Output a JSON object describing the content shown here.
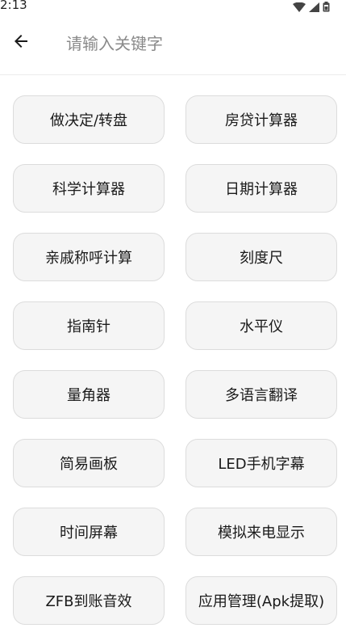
{
  "status": {
    "time": "2:13",
    "icons": [
      "wifi-icon",
      "signal-icon",
      "battery-icon"
    ]
  },
  "header": {
    "back_icon": "arrow-left-icon",
    "search_placeholder": "请输入关键字",
    "search_value": ""
  },
  "tools": [
    {
      "label": "做决定/转盘"
    },
    {
      "label": "房贷计算器"
    },
    {
      "label": "科学计算器"
    },
    {
      "label": "日期计算器"
    },
    {
      "label": "亲戚称呼计算"
    },
    {
      "label": "刻度尺"
    },
    {
      "label": "指南针"
    },
    {
      "label": "水平仪"
    },
    {
      "label": "量角器"
    },
    {
      "label": "多语言翻译"
    },
    {
      "label": "简易画板"
    },
    {
      "label": "LED手机字幕"
    },
    {
      "label": "时间屏幕"
    },
    {
      "label": "模拟来电显示"
    },
    {
      "label": "ZFB到账音效"
    },
    {
      "label": "应用管理(Apk提取)"
    }
  ],
  "colors": {
    "button_bg": "#f5f5f5",
    "button_border": "#dcdcdc",
    "text": "#1a1a1a",
    "placeholder": "#8a8a8a"
  }
}
